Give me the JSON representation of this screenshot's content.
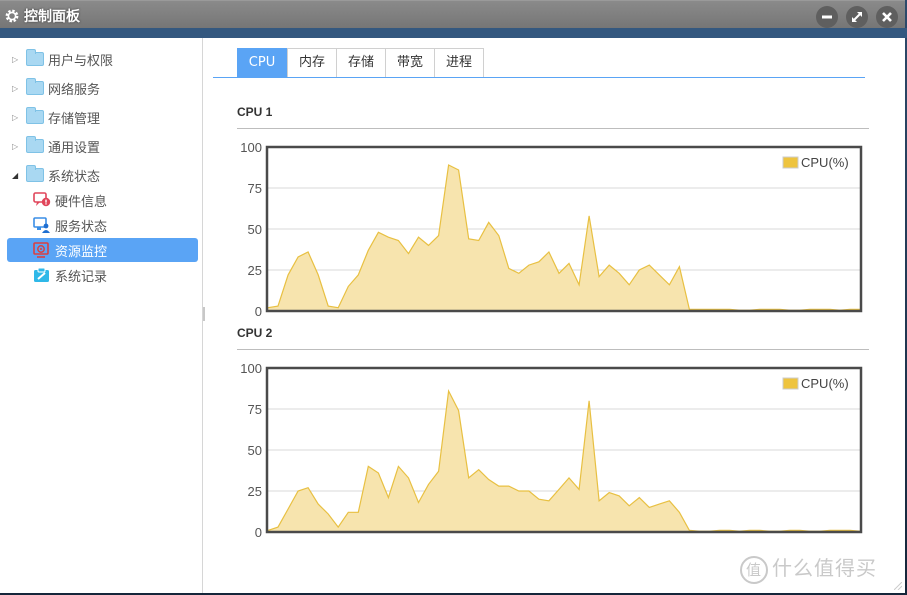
{
  "window": {
    "title": "控制面板",
    "icon": "gear-icon",
    "controls": [
      {
        "name": "minimize",
        "icon": "minus-icon"
      },
      {
        "name": "maximize",
        "icon": "expand-arrows-icon"
      },
      {
        "name": "close",
        "icon": "close-x-icon"
      }
    ]
  },
  "sidebar": {
    "items": [
      {
        "label": "用户与权限",
        "expanded": false
      },
      {
        "label": "网络服务",
        "expanded": false
      },
      {
        "label": "存储管理",
        "expanded": false
      },
      {
        "label": "通用设置",
        "expanded": false
      },
      {
        "label": "系统状态",
        "expanded": true
      }
    ],
    "sub_items": [
      {
        "label": "硬件信息",
        "icon": "hardware-info-icon",
        "active": false
      },
      {
        "label": "服务状态",
        "icon": "service-status-icon",
        "active": false
      },
      {
        "label": "资源监控",
        "icon": "resource-monitor-icon",
        "active": true
      },
      {
        "label": "系统记录",
        "icon": "system-log-icon",
        "active": false
      }
    ]
  },
  "tabs": [
    {
      "label": "CPU",
      "active": true
    },
    {
      "label": "内存",
      "active": false
    },
    {
      "label": "存储",
      "active": false
    },
    {
      "label": "带宽",
      "active": false
    },
    {
      "label": "进程",
      "active": false
    }
  ],
  "sections": [
    {
      "title": "CPU 1"
    },
    {
      "title": "CPU 2"
    }
  ],
  "colors": {
    "accent": "#5aa4f5",
    "series_line": "#e8c042",
    "series_fill": "#f7e4ae",
    "legend_swatch": "#eec43f"
  },
  "watermark": {
    "circle": "值",
    "text": "什么值得买"
  },
  "chart_data": [
    {
      "type": "area",
      "title": "CPU 1",
      "legend": [
        "CPU(%)"
      ],
      "legend_position": "top-right",
      "ylim": [
        0,
        100
      ],
      "yticks": [
        0,
        25,
        50,
        75,
        100
      ],
      "grid": true,
      "series": [
        {
          "name": "CPU(%)",
          "values": [
            2,
            3,
            22,
            33,
            36,
            22,
            3,
            2,
            15,
            22,
            37,
            48,
            45,
            43,
            35,
            45,
            40,
            46,
            89,
            86,
            44,
            43,
            54,
            46,
            26,
            23,
            28,
            30,
            36,
            23,
            29,
            16,
            58,
            21,
            28,
            23,
            16,
            25,
            28,
            22,
            16,
            27,
            1,
            1,
            1,
            1,
            1,
            0.5,
            0.5,
            1,
            1,
            1,
            0.5,
            0.5,
            1,
            1,
            1,
            0.5,
            1,
            1
          ]
        }
      ]
    },
    {
      "type": "area",
      "title": "CPU 2",
      "legend": [
        "CPU(%)"
      ],
      "legend_position": "top-right",
      "ylim": [
        0,
        100
      ],
      "yticks": [
        0,
        25,
        50,
        75,
        100
      ],
      "grid": true,
      "series": [
        {
          "name": "CPU(%)",
          "values": [
            1,
            3,
            14,
            25,
            27,
            17,
            11,
            3,
            12,
            12,
            40,
            36,
            21,
            40,
            33,
            18,
            29,
            37,
            86,
            74,
            33,
            38,
            32,
            28,
            28,
            25,
            25,
            20,
            19,
            26,
            33,
            26,
            80,
            19,
            24,
            22,
            16,
            21,
            15,
            17,
            19,
            12,
            1,
            0.5,
            0.5,
            1,
            1,
            0.5,
            1,
            1,
            0.5,
            0.5,
            1,
            1,
            0.5,
            0.5,
            1,
            1,
            1,
            0.5
          ]
        }
      ]
    }
  ]
}
